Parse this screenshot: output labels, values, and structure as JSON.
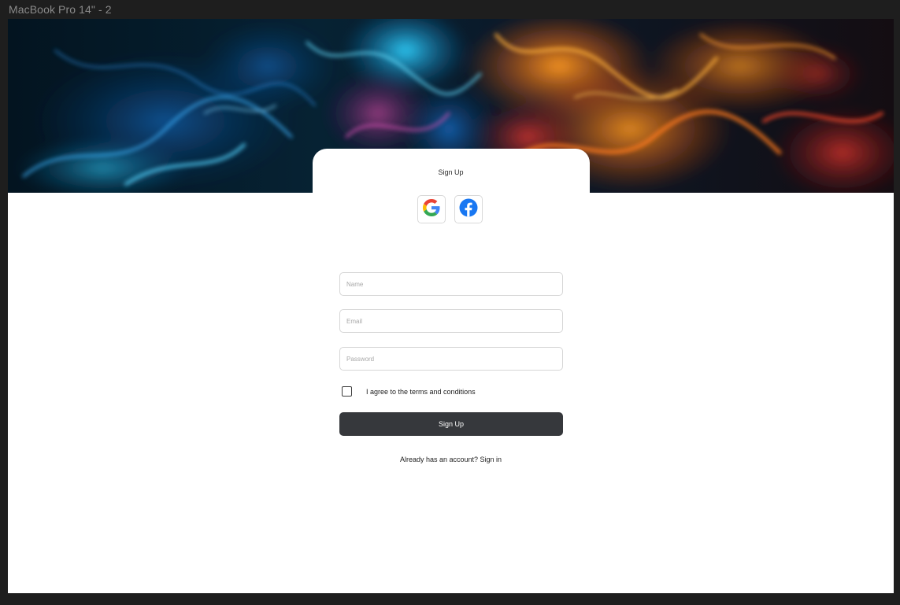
{
  "frame": {
    "label": "MacBook Pro 14\" - 2"
  },
  "form": {
    "title": "Sign Up",
    "social": {
      "google_icon": "google-icon",
      "facebook_icon": "facebook-icon"
    },
    "fields": {
      "name_placeholder": "Name",
      "email_placeholder": "Email",
      "password_placeholder": "Password"
    },
    "terms_label": "I agree to the terms and conditions",
    "terms_checked": false,
    "submit_label": "Sign Up",
    "signin_prompt": "Already has an account? Sign in"
  },
  "colors": {
    "button_bg": "#36383c",
    "facebook_blue": "#1877f2"
  }
}
